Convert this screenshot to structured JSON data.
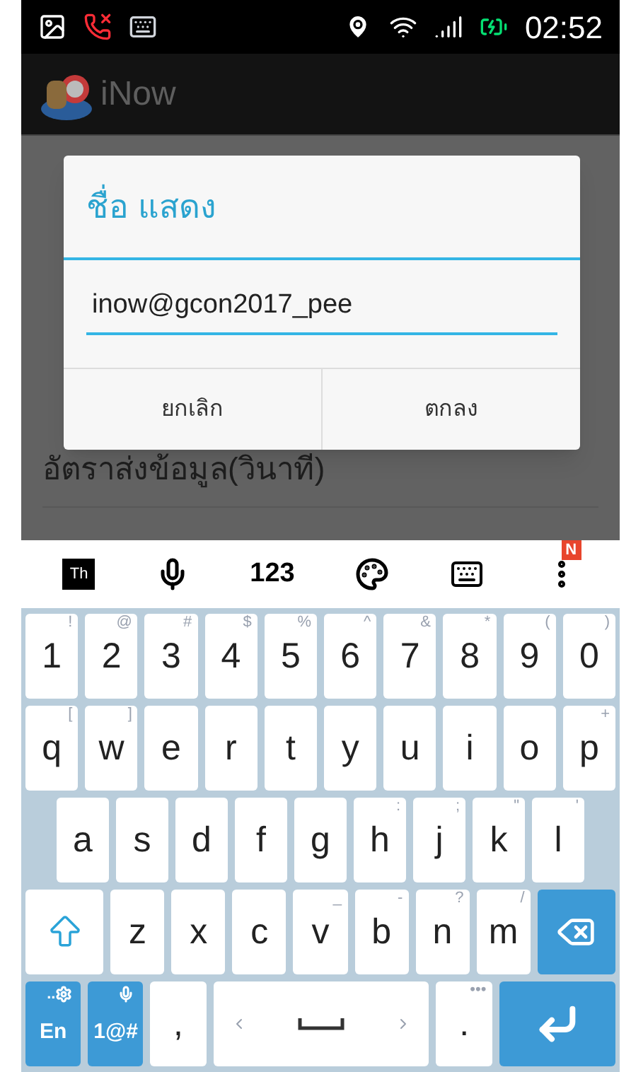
{
  "status_bar": {
    "time": "02:52"
  },
  "app_bar": {
    "title": "iNow"
  },
  "background_list": {
    "item": "อัตราส่งข้อมูล(วินาที)"
  },
  "dialog": {
    "title": "ชื่อ แสดง",
    "input_value": "inow@gcon2017_pee",
    "buttons": [
      "ยกเลิก",
      "ตกลง"
    ]
  },
  "keyboard_toolbar": {
    "language": "Th",
    "numbers": "123",
    "badge": "N"
  },
  "keyboard_rows": [
    [
      {
        "kind": "char",
        "label": "1",
        "hint": "!"
      },
      {
        "kind": "char",
        "label": "2",
        "hint": "@"
      },
      {
        "kind": "char",
        "label": "3",
        "hint": "#"
      },
      {
        "kind": "char",
        "label": "4",
        "hint": "$"
      },
      {
        "kind": "char",
        "label": "5",
        "hint": "%"
      },
      {
        "kind": "char",
        "label": "6",
        "hint": "^"
      },
      {
        "kind": "char",
        "label": "7",
        "hint": "&"
      },
      {
        "kind": "char",
        "label": "8",
        "hint": "*"
      },
      {
        "kind": "char",
        "label": "9",
        "hint": "("
      },
      {
        "kind": "char",
        "label": "0",
        "hint": ")"
      }
    ],
    [
      {
        "kind": "char",
        "label": "q",
        "hint": "["
      },
      {
        "kind": "char",
        "label": "w",
        "hint": "]"
      },
      {
        "kind": "char",
        "label": "e"
      },
      {
        "kind": "char",
        "label": "r"
      },
      {
        "kind": "char",
        "label": "t"
      },
      {
        "kind": "char",
        "label": "y"
      },
      {
        "kind": "char",
        "label": "u"
      },
      {
        "kind": "char",
        "label": "i"
      },
      {
        "kind": "char",
        "label": "o"
      },
      {
        "kind": "char",
        "label": "p",
        "hint": "+"
      }
    ],
    [
      {
        "kind": "char",
        "label": "a"
      },
      {
        "kind": "char",
        "label": "s"
      },
      {
        "kind": "char",
        "label": "d"
      },
      {
        "kind": "char",
        "label": "f"
      },
      {
        "kind": "char",
        "label": "g"
      },
      {
        "kind": "char",
        "label": "h",
        "hint": ":"
      },
      {
        "kind": "char",
        "label": "j",
        "hint": ";"
      },
      {
        "kind": "char",
        "label": "k",
        "hint": "\""
      },
      {
        "kind": "char",
        "label": "l",
        "hint": "'"
      }
    ],
    [
      {
        "kind": "shift"
      },
      {
        "kind": "char",
        "label": "z"
      },
      {
        "kind": "char",
        "label": "x"
      },
      {
        "kind": "char",
        "label": "c"
      },
      {
        "kind": "char",
        "label": "v",
        "hint": "_"
      },
      {
        "kind": "char",
        "label": "b",
        "hint": "-"
      },
      {
        "kind": "char",
        "label": "n",
        "hint": "?"
      },
      {
        "kind": "char",
        "label": "m",
        "hint": "/"
      },
      {
        "kind": "backspace"
      }
    ],
    [
      {
        "kind": "lang",
        "label": "En",
        "hint": ".."
      },
      {
        "kind": "symbols",
        "label": "1@#"
      },
      {
        "kind": "char",
        "label": ","
      },
      {
        "kind": "space"
      },
      {
        "kind": "char",
        "label": ".",
        "hint": "•••"
      },
      {
        "kind": "enter"
      }
    ]
  ]
}
